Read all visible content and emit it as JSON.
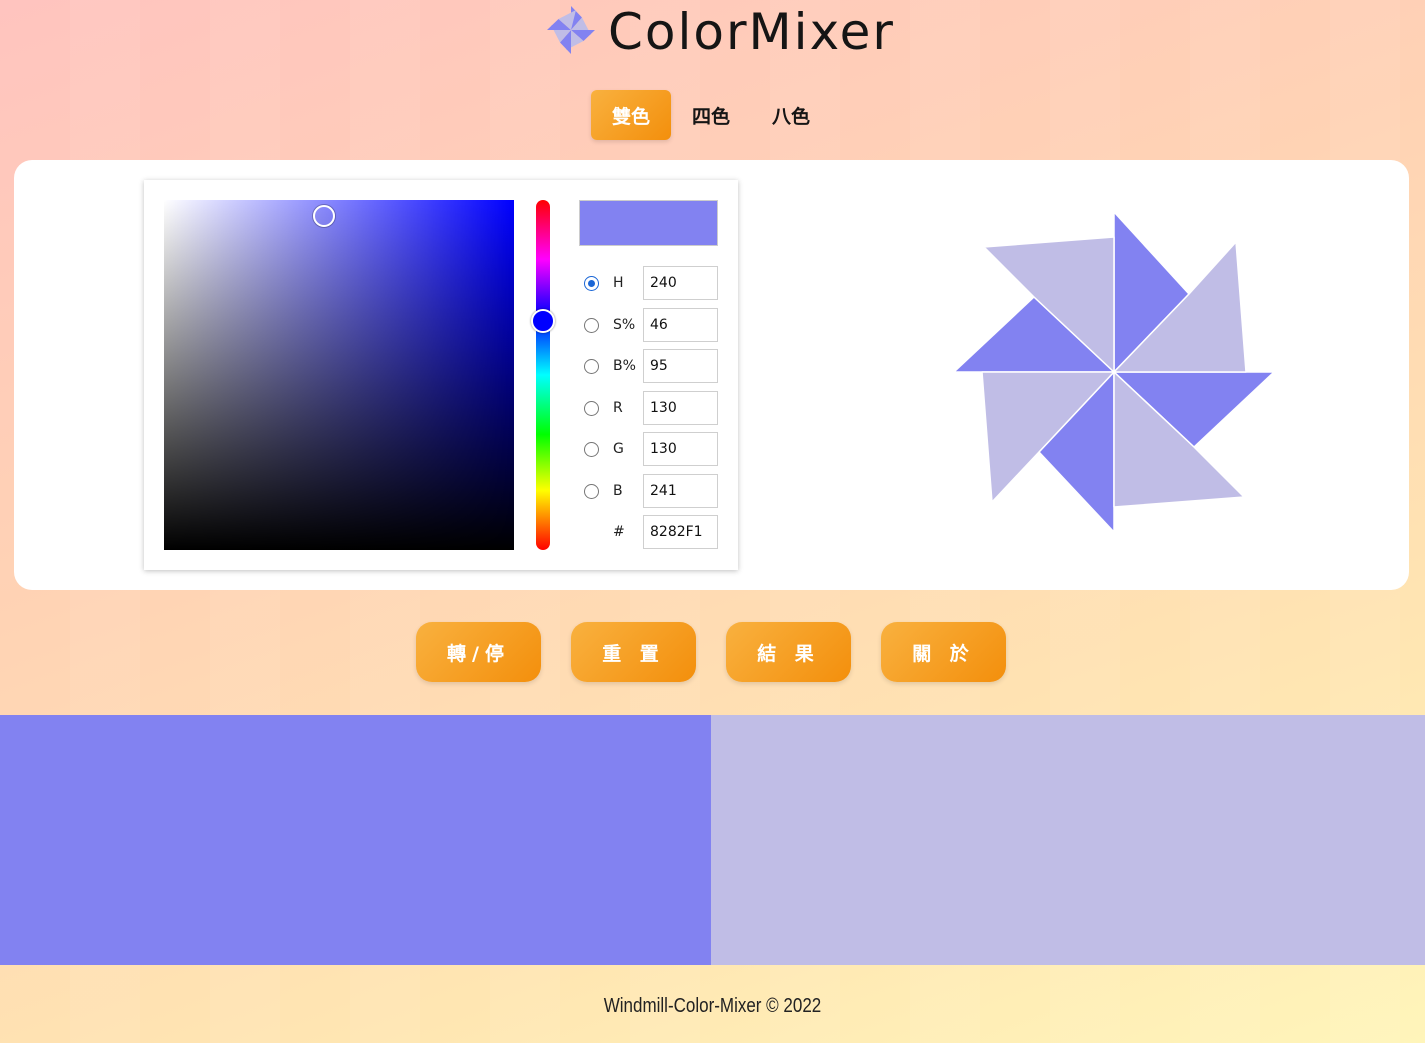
{
  "app": {
    "title": "ColorMixer",
    "logo_icon": "windmill-icon"
  },
  "tabs": [
    {
      "label": "雙色",
      "active": true
    },
    {
      "label": "四色",
      "active": false
    },
    {
      "label": "八色",
      "active": false
    }
  ],
  "picker": {
    "hue_level": 240,
    "current_color": "#8282F1",
    "fields": [
      {
        "label": "H",
        "value": "240",
        "selected": true
      },
      {
        "label": "S%",
        "value": "46",
        "selected": false
      },
      {
        "label": "B%",
        "value": "95",
        "selected": false
      },
      {
        "label": "R",
        "value": "130",
        "selected": false
      },
      {
        "label": "G",
        "value": "130",
        "selected": false
      },
      {
        "label": "B",
        "value": "241",
        "selected": false
      },
      {
        "label": "#",
        "value": "8282F1",
        "selected": false
      }
    ]
  },
  "windmill": {
    "primary_color": "#8282F1",
    "secondary_color": "#C0BDE6"
  },
  "actions": {
    "spin_label": "轉/停",
    "reset_label": "重 置",
    "result_label": "結 果",
    "about_label": "關 於"
  },
  "swatches": {
    "left_color": "#8282F1",
    "right_color": "#C0BDE6"
  },
  "footer": {
    "text": "Windmill-Color-Mixer © 2022"
  }
}
